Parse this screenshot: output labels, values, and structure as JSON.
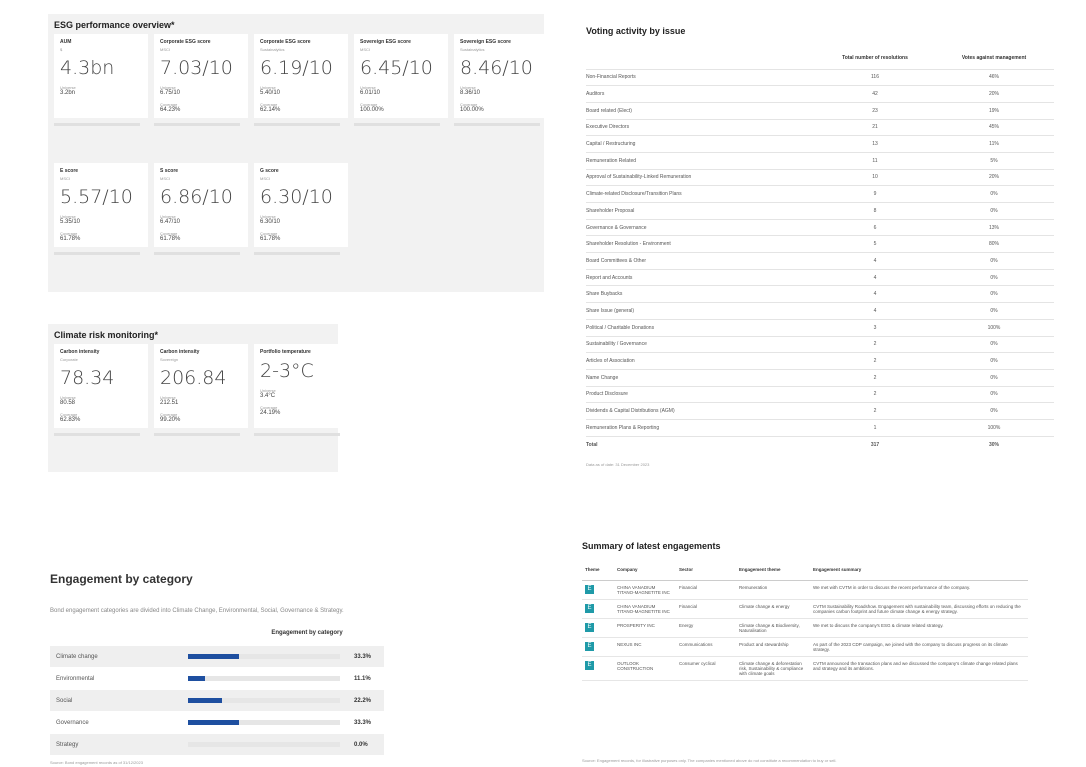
{
  "esg": {
    "title": "ESG performance overview*",
    "row1": [
      {
        "label": "AUM",
        "sub": "$",
        "value": "4.3bn",
        "k1": "Universe",
        "v1": "3.2bn",
        "k2": "",
        "v2": ""
      },
      {
        "label": "Corporate ESG score",
        "sub": "MSCI",
        "value": "7.03/10",
        "k1": "Universe",
        "v1": "6.75/10",
        "k2": "Coverage",
        "v2": "64.23%"
      },
      {
        "label": "Corporate ESG score",
        "sub": "Sustainalytics",
        "value": "6.19/10",
        "k1": "Universe",
        "v1": "5.40/10",
        "k2": "Coverage",
        "v2": "62.14%"
      },
      {
        "label": "Sovereign ESG score",
        "sub": "MSCI",
        "value": "6.45/10",
        "k1": "Universe",
        "v1": "6.01/10",
        "k2": "Coverage",
        "v2": "100.00%"
      },
      {
        "label": "Sovereign ESG score",
        "sub": "Sustainalytics",
        "value": "8.46/10",
        "k1": "Universe",
        "v1": "8.36/10",
        "k2": "Coverage",
        "v2": "100.00%"
      }
    ],
    "row2": [
      {
        "label": "E score",
        "sub": "MSCI",
        "value": "5.57/10",
        "k1": "Universe",
        "v1": "5.35/10",
        "k2": "Coverage",
        "v2": "61.78%"
      },
      {
        "label": "S score",
        "sub": "MSCI",
        "value": "6.86/10",
        "k1": "Universe",
        "v1": "6.47/10",
        "k2": "Coverage",
        "v2": "61.78%"
      },
      {
        "label": "G score",
        "sub": "MSCI",
        "value": "6.30/10",
        "k1": "Universe",
        "v1": "6.30/10",
        "k2": "Coverage",
        "v2": "61.78%"
      }
    ]
  },
  "climate": {
    "title": "Climate risk monitoring*",
    "cards": [
      {
        "label": "Carbon intensity",
        "sub": "Corporate",
        "value": "78.34",
        "k1": "Universe",
        "v1": "80.58",
        "k2": "Coverage",
        "v2": "62.83%"
      },
      {
        "label": "Carbon intensity",
        "sub": "Sovereign",
        "value": "206.84",
        "k1": "Universe",
        "v1": "212.51",
        "k2": "Coverage",
        "v2": "99.20%"
      },
      {
        "label": "Portfolio temperature",
        "sub": "",
        "value": "2-3°C",
        "k1": "Universe",
        "v1": "3.4°C",
        "k2": "Coverage",
        "v2": "24.19%"
      }
    ]
  },
  "voting": {
    "title": "Voting activity by issue",
    "headers": [
      "",
      "Total number of resolutions",
      "Votes against management"
    ],
    "rows": [
      [
        "Non-Financial Reports",
        "116",
        "46%"
      ],
      [
        "Auditors",
        "42",
        "20%"
      ],
      [
        "Board related (Elect)",
        "23",
        "19%"
      ],
      [
        "Executive Directors",
        "21",
        "45%"
      ],
      [
        "Capital / Restructuring",
        "13",
        "11%"
      ],
      [
        "Remuneration Related",
        "11",
        "5%"
      ],
      [
        "Approval of Sustainability-Linked Remuneration",
        "10",
        "20%"
      ],
      [
        "Climate-related Disclosure/Transition Plans",
        "9",
        "0%"
      ],
      [
        "Shareholder Proposal",
        "8",
        "0%"
      ],
      [
        "Governance & Governance",
        "6",
        "13%"
      ],
      [
        "Shareholder Resolution - Environment",
        "5",
        "80%"
      ],
      [
        "Board Committees & Other",
        "4",
        "0%"
      ],
      [
        "Report and Accounts",
        "4",
        "0%"
      ],
      [
        "Share Buybacks",
        "4",
        "0%"
      ],
      [
        "Share Issue (general)",
        "4",
        "0%"
      ],
      [
        "Political / Charitable Donations",
        "3",
        "100%"
      ],
      [
        "Sustainability / Governance",
        "2",
        "0%"
      ],
      [
        "Articles of Association",
        "2",
        "0%"
      ],
      [
        "Name Change",
        "2",
        "0%"
      ],
      [
        "Product Disclosure",
        "2",
        "0%"
      ],
      [
        "Dividends & Capital Distributions (AGM)",
        "2",
        "0%"
      ],
      [
        "Remuneration Plans & Reporting",
        "1",
        "100%"
      ],
      [
        "Total",
        "317",
        "30%"
      ]
    ],
    "note": "Data as of date: 31 December 2023"
  },
  "category": {
    "title": "Engagement by category",
    "desc": "Bond engagement categories are divided into Climate Change, Environmental, Social, Governance & Strategy.",
    "chart_data": {
      "type": "bar",
      "title": "Engagement by category",
      "categories": [
        "Climate change",
        "Environmental",
        "Social",
        "Governance",
        "Strategy"
      ],
      "values": [
        33.3,
        11.1,
        22.2,
        33.3,
        0.0
      ],
      "labels": [
        "33.3%",
        "11.1%",
        "22.2%",
        "33.3%",
        "0.0%"
      ],
      "xlim": [
        0,
        100
      ]
    },
    "note": "Source: Bond engagement records as of 31/12/2023"
  },
  "engagements": {
    "title": "Summary of latest engagements",
    "headers": [
      "Theme",
      "Company",
      "Sector",
      "Engagement theme",
      "Engagement summary"
    ],
    "rows": [
      {
        "icon": "E",
        "company": "CHINA VANADIUM TITANO-MAGNETITE INC",
        "sector": "Financial",
        "theme": "Remuneration",
        "summary": "We met with CVTM in order to discuss the recent performance of the company."
      },
      {
        "icon": "E",
        "company": "CHINA VANADIUM TITANO-MAGNETITE INC",
        "sector": "Financial",
        "theme": "Climate change & energy",
        "summary": "CVTM Sustainability Roadshow. Engagement with sustainability team, discussing efforts on reducing the companies carbon footprint and future climate change & energy strategy."
      },
      {
        "icon": "E",
        "company": "PROSPERITY INC",
        "sector": "Energy",
        "theme": "Climate change & Biodiversity, Naturalisation",
        "summary": "We met to discuss the company's ESG & climate related strategy."
      },
      {
        "icon": "E",
        "company": "NEXUS INC",
        "sector": "Communications",
        "theme": "Product and stewardship",
        "summary": "As part of the 2023 CDP campaign, we joined with the company to discuss progress on its climate strategy."
      },
      {
        "icon": "E",
        "company": "OUTLOOK CONSTRUCTION",
        "sector": "Consumer cyclical",
        "theme": "Climate change & deforestation risk, Sustainability & compliance with climate goals",
        "summary": "CVTM announced the transaction plans and we discussed the company's climate change related plans and strategy and its ambitions."
      }
    ],
    "note": "Source: Engagement records, for illustrative purposes only. The companies mentioned above do not constitute a recommendation to buy or sell."
  }
}
